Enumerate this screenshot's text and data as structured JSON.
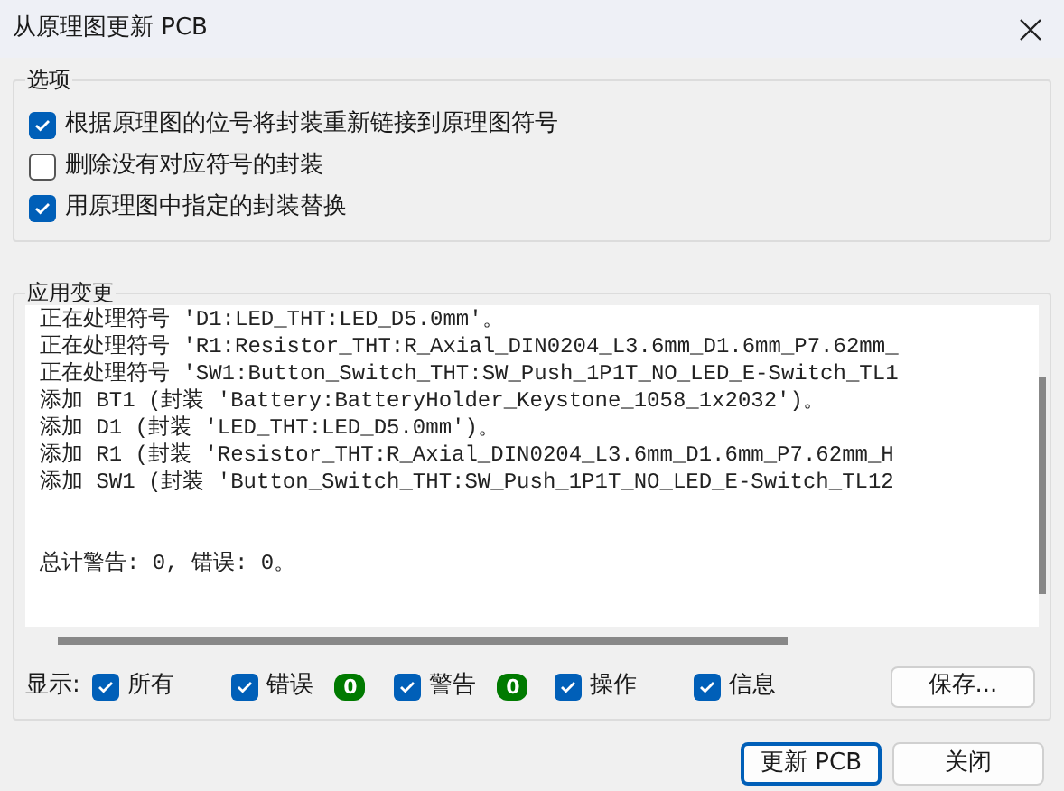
{
  "window": {
    "title": "从原理图更新 PCB"
  },
  "options": {
    "title": "选项",
    "items": [
      {
        "label": "根据原理图的位号将封装重新链接到原理图符号",
        "checked": true
      },
      {
        "label": "删除没有对应符号的封装",
        "checked": false
      },
      {
        "label": "用原理图中指定的封装替换",
        "checked": true
      }
    ]
  },
  "changes": {
    "title": "应用变更",
    "log": [
      "正在处理符号 'D1:LED_THT:LED_D5.0mm'。",
      "正在处理符号 'R1:Resistor_THT:R_Axial_DIN0204_L3.6mm_D1.6mm_P7.62mm_",
      "正在处理符号 'SW1:Button_Switch_THT:SW_Push_1P1T_NO_LED_E-Switch_TL1",
      "添加 BT1 (封装 'Battery:BatteryHolder_Keystone_1058_1x2032')。",
      "添加 D1 (封装 'LED_THT:LED_D5.0mm')。",
      "添加 R1 (封装 'Resistor_THT:R_Axial_DIN0204_L3.6mm_D1.6mm_P7.62mm_H",
      "添加 SW1 (封装 'Button_Switch_THT:SW_Push_1P1T_NO_LED_E-Switch_TL12"
    ],
    "summary": "总计警告: 0, 错误: 0。"
  },
  "filter": {
    "label": "显示:",
    "items": [
      {
        "label": "所有",
        "checked": true
      },
      {
        "label": "错误",
        "checked": true,
        "count": "0"
      },
      {
        "label": "警告",
        "checked": true,
        "count": "0"
      },
      {
        "label": "操作",
        "checked": true
      },
      {
        "label": "信息",
        "checked": true
      }
    ],
    "save_button": "保存..."
  },
  "buttons": [
    {
      "label": "更新 PCB",
      "default": true
    },
    {
      "label": "关闭",
      "default": false
    }
  ]
}
